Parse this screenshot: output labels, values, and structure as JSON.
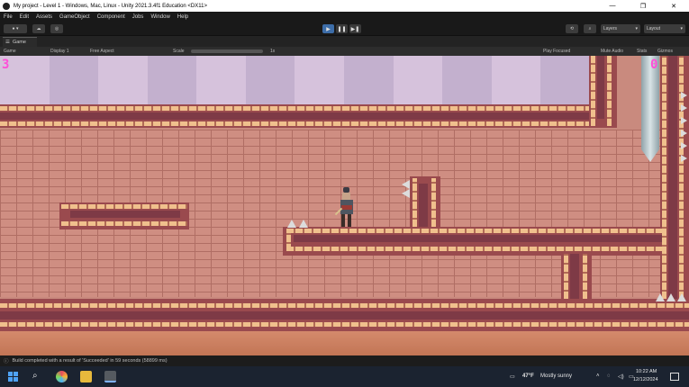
{
  "window": {
    "title": "My project - Level 1 - Windows, Mac, Linux - Unity 2021.3.4f1 Education <DX11>",
    "minimize": "—",
    "maximize": "❐",
    "close": "✕"
  },
  "menu": [
    "File",
    "Edit",
    "Assets",
    "GameObject",
    "Component",
    "Jobs",
    "Window",
    "Help"
  ],
  "toolbar": {
    "layers_label": "Layers",
    "layout_label": "Layout"
  },
  "tab": {
    "label": "Game"
  },
  "gamebar": {
    "view": "Game",
    "display": "Display 1",
    "aspect": "Free Aspect",
    "scale_label": "Scale",
    "scale_value": "1x",
    "play_focused": "Play Focused",
    "mute_audio": "Mute Audio",
    "stats": "Stats",
    "gizmos": "Gizmos"
  },
  "hud": {
    "left_number": "3",
    "right_number": "0"
  },
  "colors": {
    "sky_a": "#d6c2dc",
    "sky_b": "#c3b0ce",
    "hud": "#ff4fd8",
    "brick": "#cf8e82",
    "trim_light": "#f0c08d",
    "trim_dark": "#9a4a4e"
  },
  "status": {
    "message": "Build completed with a result of 'Succeeded' in 59 seconds (58899 ms)"
  },
  "taskbar": {
    "weather_temp": "47°F",
    "weather_desc": "Mostly sunny",
    "time": "10:22 AM",
    "date": "12/12/2024"
  }
}
